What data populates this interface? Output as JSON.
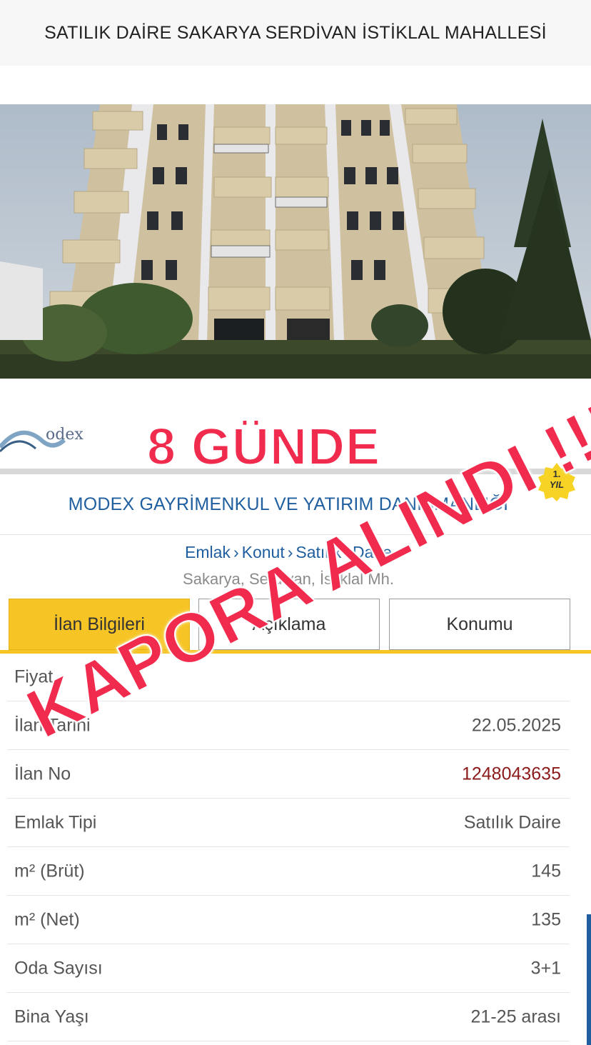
{
  "header": {
    "title": "SATILIK DAİRE SAKARYA SERDİVAN İSTİKLAL MAHALLESİ"
  },
  "overlay": {
    "top_text": "8 GÜNDE",
    "stamp_text": "KAPORA ALINDI !!!"
  },
  "agency": {
    "logo_text": "odex",
    "name": "MODEX GAYRİMENKUL VE YATIRIM DANIŞMANLIĞI",
    "badge": {
      "line1": "1.",
      "line2": "YIL"
    }
  },
  "breadcrumb": [
    "Emlak",
    "Konut",
    "Satılık",
    "Daire"
  ],
  "breadcrumb_sep": "›",
  "location": "Sakarya, Serdivan, İstiklal Mh.",
  "tabs": [
    {
      "label": "İlan Bilgileri",
      "active": true
    },
    {
      "label": "Açıklama",
      "active": false
    },
    {
      "label": "Konumu",
      "active": false
    }
  ],
  "details": [
    {
      "key": "Fiyat",
      "value": ""
    },
    {
      "key": "İlan Tarihi",
      "value": "22.05.2025"
    },
    {
      "key": "İlan No",
      "value": "1248043635"
    },
    {
      "key": "Emlak Tipi",
      "value": "Satılık Daire"
    },
    {
      "key": "m² (Brüt)",
      "value": "145"
    },
    {
      "key": "m² (Net)",
      "value": "135"
    },
    {
      "key": "Oda Sayısı",
      "value": "3+1"
    },
    {
      "key": "Bina Yaşı",
      "value": "21-25 arası"
    }
  ],
  "colors": {
    "accent_yellow": "#f6c525",
    "overlay_red": "#f12b4d",
    "link_blue": "#1f5f9f",
    "ilan_no_red": "#8b1a1a"
  }
}
